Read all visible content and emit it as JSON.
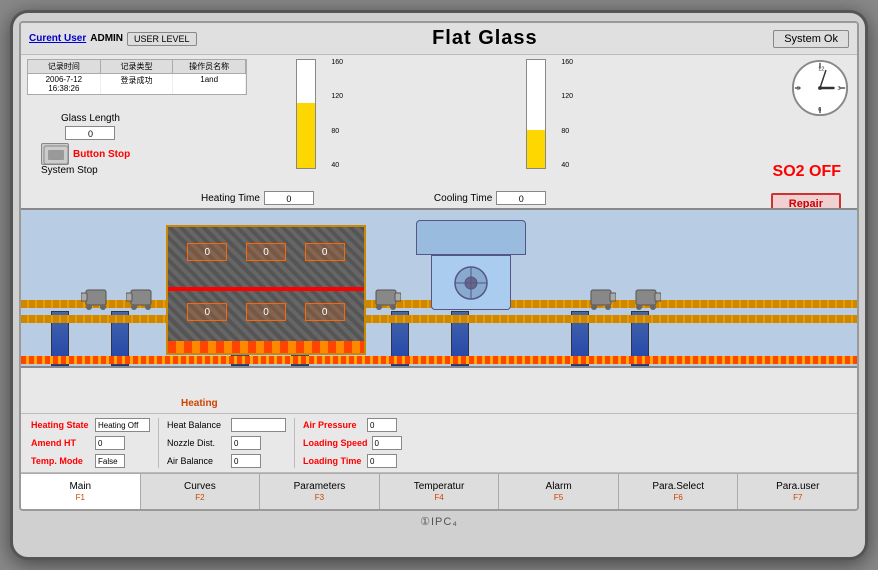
{
  "monitor": {
    "title": "Flat Glass",
    "system_status": "System Ok",
    "logo": "①IPC₄"
  },
  "topbar": {
    "current_user_label": "Curent User",
    "user_name": "ADMIN",
    "user_level_btn": "USER LEVEL"
  },
  "log_table": {
    "headers": [
      "记录时间",
      "记录类型",
      "操作员名称"
    ],
    "rows": [
      [
        "2006-7-12 16:38:26",
        "登录成功",
        "1and"
      ]
    ]
  },
  "glass_length": {
    "label": "Glass Length",
    "value": "0"
  },
  "controls": {
    "button_stop": "Button Stop",
    "system_stop": "System Stop",
    "heating_time_label": "Heating Time",
    "heating_time_value": "0",
    "cooling_time_label": "Cooling Time",
    "cooling_time_value": "0",
    "so2_status": "SO2 OFF",
    "repair_btn": "Repair"
  },
  "gauges": {
    "left_values": [
      "160",
      "120",
      "80",
      "40"
    ],
    "right_values": [
      "160",
      "120",
      "80",
      "40"
    ]
  },
  "status_panel": {
    "heating_state_label": "Heating State",
    "heating_state_value": "Heating Off",
    "amend_ht_label": "Amend  HT",
    "amend_ht_value": "0",
    "temp_mode_label": "Temp. Mode",
    "temp_mode_value": "False",
    "heat_balance_label": "Heat Balance",
    "heat_balance_value": "",
    "nozzle_dist_label": "Nozzle Dist.",
    "nozzle_dist_value": "0",
    "air_balance_label": "Air Balance",
    "air_balance_value": "0",
    "air_pressure_label": "Air Pressure",
    "air_pressure_value": "0",
    "loading_speed_label": "Loading Speed",
    "loading_speed_value": "0",
    "loading_time_label": "Loading Time",
    "loading_time_value": "0"
  },
  "furnace_cells": {
    "top_row": [
      "0",
      "0",
      "0"
    ],
    "bottom_row": [
      "0",
      "0",
      "0"
    ]
  },
  "navigation": {
    "items": [
      {
        "label": "Main",
        "fn": "F1"
      },
      {
        "label": "Curves",
        "fn": "F2"
      },
      {
        "label": "Parameters",
        "fn": "F3"
      },
      {
        "label": "Temperatur",
        "fn": "F4"
      },
      {
        "label": "Alarm",
        "fn": "F5"
      },
      {
        "label": "Para.Select",
        "fn": "F6"
      },
      {
        "label": "Para.user",
        "fn": "F7"
      }
    ]
  },
  "clock": {
    "hour_angle": 90,
    "minute_angle": 25
  }
}
